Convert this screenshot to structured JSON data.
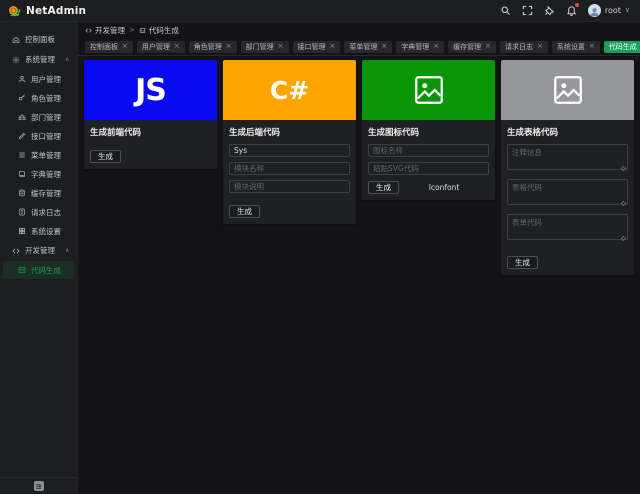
{
  "colors": {
    "accent": "#18a058",
    "topbar_bg": "#1d1e20",
    "content_bg": "#141416"
  },
  "icons": {
    "chevron_up": "∧",
    "chevron_down": "∨",
    "close": "×",
    "breadcrumb_sep": ">"
  },
  "topbar": {
    "app_name": "NetAdmin",
    "logo_icon": "snail-icon",
    "user": "root",
    "right_icons": [
      "search-icon",
      "fullscreen-icon",
      "pin-icon",
      "bell-icon"
    ]
  },
  "breadcrumb": {
    "parent": "开发管理",
    "current": "代码生成"
  },
  "tab_bar": {
    "tabs": [
      {
        "label": "控制面板",
        "active": false
      },
      {
        "label": "用户管理",
        "active": false
      },
      {
        "label": "角色管理",
        "active": false
      },
      {
        "label": "部门管理",
        "active": false
      },
      {
        "label": "接口管理",
        "active": false
      },
      {
        "label": "菜单管理",
        "active": false
      },
      {
        "label": "字典管理",
        "active": false
      },
      {
        "label": "缓存管理",
        "active": false
      },
      {
        "label": "请求日志",
        "active": false
      },
      {
        "label": "系统设置",
        "active": false
      },
      {
        "label": "代码生成",
        "active": true
      }
    ]
  },
  "sidebar": {
    "items": [
      {
        "label": "控制面板",
        "icon": "dashboard-icon",
        "level": "top"
      },
      {
        "label": "系统管理",
        "icon": "gear-icon",
        "level": "group",
        "expanded": true
      },
      {
        "label": "用户管理",
        "icon": "user-icon",
        "level": "sub"
      },
      {
        "label": "角色管理",
        "icon": "role-icon",
        "level": "sub"
      },
      {
        "label": "部门管理",
        "icon": "department-icon",
        "level": "sub"
      },
      {
        "label": "接口管理",
        "icon": "api-icon",
        "level": "sub"
      },
      {
        "label": "菜单管理",
        "icon": "menu-icon",
        "level": "sub"
      },
      {
        "label": "字典管理",
        "icon": "dictionary-icon",
        "level": "sub"
      },
      {
        "label": "缓存管理",
        "icon": "cache-icon",
        "level": "sub"
      },
      {
        "label": "请求日志",
        "icon": "log-icon",
        "level": "sub"
      },
      {
        "label": "系统设置",
        "icon": "settings-icon",
        "level": "sub"
      },
      {
        "label": "开发管理",
        "icon": "code-icon",
        "level": "group",
        "expanded": true
      },
      {
        "label": "代码生成",
        "icon": "codegen-icon",
        "level": "sub",
        "active": true
      }
    ]
  },
  "cards": [
    {
      "banner_text": "JS",
      "banner_color": "#0a0af2",
      "title": "生成前端代码",
      "button": "生成"
    },
    {
      "banner_text": "C#",
      "banner_color": "#ffa502",
      "title": "生成后端代码",
      "fields": [
        {
          "value": "Sys",
          "placeholder": ""
        },
        {
          "placeholder": "模块名称"
        },
        {
          "placeholder": "模块说明"
        }
      ],
      "button": "生成"
    },
    {
      "banner_icon": "image-icon",
      "banner_color": "#0a9408",
      "title": "生成图标代码",
      "fields": [
        {
          "placeholder": "图标名称"
        },
        {
          "placeholder": "粘贴SVG代码"
        }
      ],
      "button": "生成",
      "link": "Iconfont"
    },
    {
      "banner_icon": "image-icon",
      "banner_color": "#96979b",
      "title": "生成表格代码",
      "fields": [
        {
          "placeholder": "注释信息"
        },
        {
          "placeholder": "表格代码"
        },
        {
          "placeholder": "表单代码"
        }
      ],
      "button": "生成"
    }
  ]
}
